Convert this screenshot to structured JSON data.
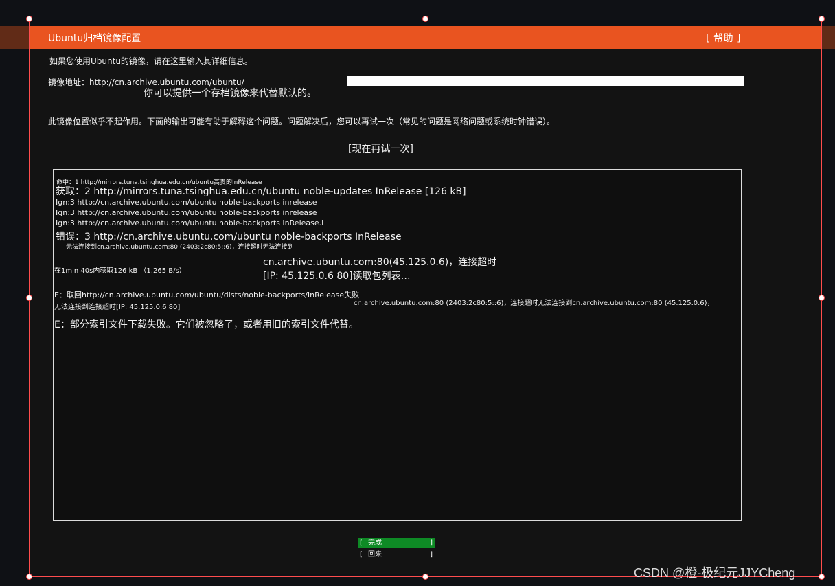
{
  "dialog": {
    "title": "Ubuntu归档镜像配置",
    "help": "[ 帮助 ]",
    "intro": "如果您使用Ubuntu的镜像，请在这里输入其详细信息。",
    "mirror_label": "镜像地址：http://cn.archive.ubuntu.com/ubuntu/",
    "mirror_hint": "你可以提供一个存档镜像来代替默认的。",
    "error_message": "此镜像位置似乎不起作用。下面的输出可能有助于解释这个问题。问题解决后，您可以再试一次（常见的问题是网络问题或系统时钟错误）。",
    "retry": "[现在再试一次]"
  },
  "log": {
    "l1": "命中：1 http://mirrors.tuna.tsinghua.edu.cn/ubuntu高贵的InRelease",
    "l2": "获取：2 http://mirrors.tuna.tsinghua.edu.cn/ubuntu noble-updates InRelease [126 kB]",
    "l3": "Ign:3 http://cn.archive.ubuntu.com/ubuntu noble-backports inrelease",
    "l4": "Ign:3 http://cn.archive.ubuntu.com/ubuntu noble-backports inrelease",
    "l5": "Ign:3 http://cn.archive.ubuntu.com/ubuntu noble-backports InRelease.l",
    "l6": "错误：3 http://cn.archive.ubuntu.com/ubuntu noble-backports InRelease",
    "l7": "无法连接到cn.archive.ubuntu.com:80 (2403:2c80:5::6)，连接超时无法连接到",
    "l8": "cn.archive.ubuntu.com:80(45.125.0.6)，连接超时",
    "l9": "在1min 40s内获取126 kB （1,265 B/s）",
    "l10": "[IP: 45.125.0.6 80]读取包列表…",
    "l11": "E：取回http://cn.archive.ubuntu.com/ubuntu/dists/noble-backports/InRelease失败",
    "l12": "无法连接到连接超时[IP: 45.125.0.6 80]",
    "l13": "cn.archive.ubuntu.com:80 (2403:2c80:5::6)，连接超时无法连接到cn.archive.ubuntu.com:80 (45.125.0.6)，",
    "l14": "E：部分索引文件下载失败。它们被忽略了，或者用旧的索引文件代替。"
  },
  "buttons": {
    "done": "完成",
    "back": "回来",
    "open_bracket": "[",
    "close_bracket": "]"
  },
  "watermark": "CSDN @橙-极纪元JJYCheng",
  "colors": {
    "accent": "#e95420",
    "done_button": "#0e8a25",
    "background": "#131313"
  }
}
